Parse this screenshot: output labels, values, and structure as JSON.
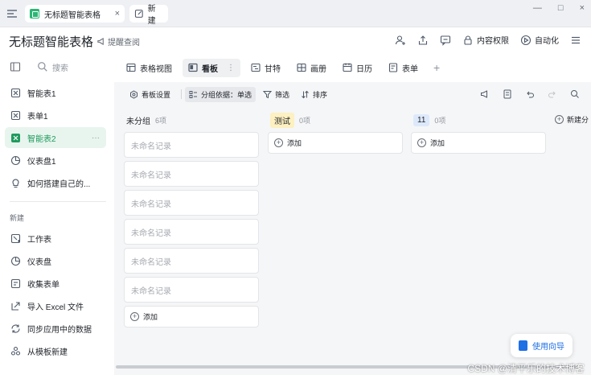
{
  "tabstrip": {
    "active_tab": "无标题智能表格",
    "new_tab": "新建",
    "close": "×",
    "window": {
      "minimize": "—",
      "maximize": "□",
      "close": "×"
    }
  },
  "header": {
    "title": "无标题智能表格",
    "reminder": "提醒查阅",
    "permission": "内容权限",
    "automation": "自动化"
  },
  "sidebar": {
    "search_placeholder": "搜索",
    "items": [
      {
        "label": "智能表1",
        "icon": "smart-table-icon"
      },
      {
        "label": "表单1",
        "icon": "form-icon"
      },
      {
        "label": "智能表2",
        "icon": "smart-table-icon",
        "active": true,
        "more": "···"
      },
      {
        "label": "仪表盘1",
        "icon": "dashboard-icon"
      },
      {
        "label": "如何搭建自己的...",
        "icon": "lightbulb-icon"
      }
    ],
    "new_section": "新建",
    "new_items": [
      {
        "label": "工作表",
        "icon": "worksheet-icon"
      },
      {
        "label": "仪表盘",
        "icon": "dashboard-icon"
      },
      {
        "label": "收集表单",
        "icon": "collect-form-icon"
      },
      {
        "label": "导入 Excel 文件",
        "icon": "import-icon"
      },
      {
        "label": "同步应用中的数据",
        "icon": "sync-icon"
      },
      {
        "label": "从模板新建",
        "icon": "template-icon"
      }
    ]
  },
  "views": {
    "tabs": [
      {
        "label": "表格视图",
        "icon": "grid-view-icon"
      },
      {
        "label": "看板",
        "icon": "kanban-icon",
        "active": true
      },
      {
        "label": "甘特",
        "icon": "gantt-icon"
      },
      {
        "label": "画册",
        "icon": "gallery-icon"
      },
      {
        "label": "日历",
        "icon": "calendar-icon"
      },
      {
        "label": "表单",
        "icon": "form-icon"
      }
    ],
    "more": "⋮",
    "add": "+"
  },
  "toolbar": {
    "board_settings": "看板设置",
    "group_by": "分组依据：单选",
    "filter": "筛选",
    "sort": "排序"
  },
  "board": {
    "columns": [
      {
        "title": "未分组",
        "count": "6项",
        "style": "plain",
        "cards": [
          "未命名记录",
          "未命名记录",
          "未命名记录",
          "未命名记录",
          "未命名记录",
          "未命名记录"
        ],
        "add_label": "添加"
      },
      {
        "title": "测试",
        "count": "0项",
        "style": "yellow",
        "cards": [],
        "add_label": "添加"
      },
      {
        "title": "11",
        "count": "0项",
        "style": "blue",
        "cards": [],
        "add_label": "添加"
      }
    ],
    "new_group": "新建分"
  },
  "guide": {
    "label": "使用向导"
  },
  "watermark": "CSDN @清平乐的技术博客"
}
